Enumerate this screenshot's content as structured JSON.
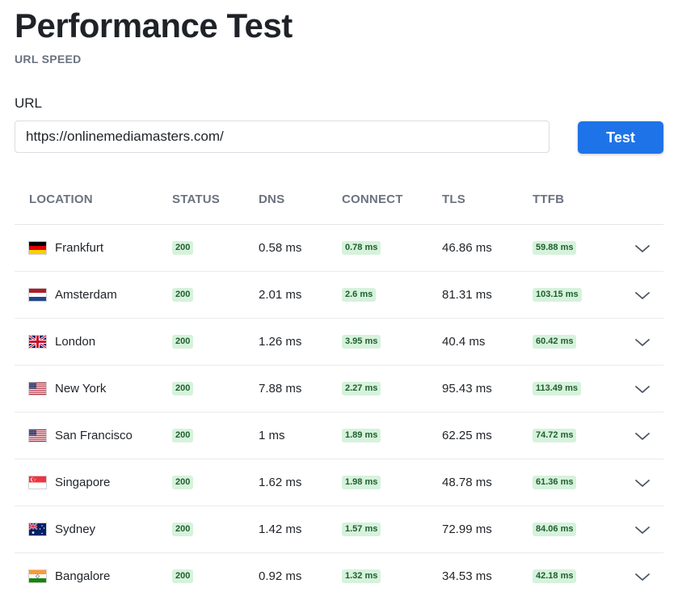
{
  "header": {
    "title": "Performance Test",
    "subtitle": "URL SPEED"
  },
  "form": {
    "url_label": "URL",
    "url_value": "https://onlinemediamasters.com/",
    "test_button": "Test"
  },
  "table": {
    "columns": [
      "LOCATION",
      "STATUS",
      "DNS",
      "CONNECT",
      "TLS",
      "TTFB"
    ],
    "rows": [
      {
        "flag": "germany-flag",
        "location": "Frankfurt",
        "status": "200",
        "dns": "0.58 ms",
        "connect": "0.78 ms",
        "tls": "46.86 ms",
        "ttfb": "59.88 ms"
      },
      {
        "flag": "netherlands-flag",
        "location": "Amsterdam",
        "status": "200",
        "dns": "2.01 ms",
        "connect": "2.6 ms",
        "tls": "81.31 ms",
        "ttfb": "103.15 ms"
      },
      {
        "flag": "uk-flag",
        "location": "London",
        "status": "200",
        "dns": "1.26 ms",
        "connect": "3.95 ms",
        "tls": "40.4 ms",
        "ttfb": "60.42 ms"
      },
      {
        "flag": "usa-flag",
        "location": "New York",
        "status": "200",
        "dns": "7.88 ms",
        "connect": "2.27 ms",
        "tls": "95.43 ms",
        "ttfb": "113.49 ms"
      },
      {
        "flag": "usa-flag",
        "location": "San Francisco",
        "status": "200",
        "dns": "1 ms",
        "connect": "1.89 ms",
        "tls": "62.25 ms",
        "ttfb": "74.72 ms"
      },
      {
        "flag": "singapore-flag",
        "location": "Singapore",
        "status": "200",
        "dns": "1.62 ms",
        "connect": "1.98 ms",
        "tls": "48.78 ms",
        "ttfb": "61.36 ms"
      },
      {
        "flag": "australia-flag",
        "location": "Sydney",
        "status": "200",
        "dns": "1.42 ms",
        "connect": "1.57 ms",
        "tls": "72.99 ms",
        "ttfb": "84.06 ms"
      },
      {
        "flag": "india-flag",
        "location": "Bangalore",
        "status": "200",
        "dns": "0.92 ms",
        "connect": "1.32 ms",
        "tls": "34.53 ms",
        "ttfb": "42.18 ms"
      }
    ]
  },
  "colors": {
    "accent": "#1f73e8",
    "badge_bg": "#d6f2dc",
    "badge_text": "#1f5f2c",
    "muted_text": "#6b7280"
  }
}
